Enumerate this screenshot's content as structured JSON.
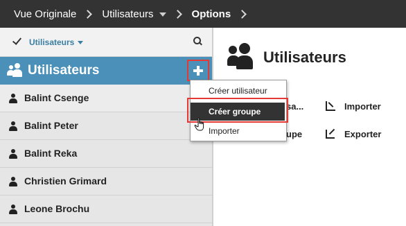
{
  "breadcrumb": {
    "items": [
      {
        "label": "Vue Originale"
      },
      {
        "label": "Utilisateurs"
      },
      {
        "label": "Options"
      }
    ]
  },
  "filter": {
    "label": "Utilisateurs"
  },
  "section": {
    "title": "Utilisateurs"
  },
  "users": [
    {
      "name": "Balint Csenge"
    },
    {
      "name": "Balint Peter"
    },
    {
      "name": "Balint Reka"
    },
    {
      "name": "Christien Grimard"
    },
    {
      "name": "Leone Brochu"
    }
  ],
  "main": {
    "title": "Utilisateurs",
    "actions": {
      "partial_left_1": "sa...",
      "partial_left_2": "upe",
      "import": "Importer",
      "export": "Exporter"
    }
  },
  "menu": {
    "items": [
      {
        "label": "Créer utilisateur"
      },
      {
        "label": "Créer groupe"
      },
      {
        "label": "Importer"
      }
    ]
  },
  "colors": {
    "topbar": "#333333",
    "accent": "#4a90b8",
    "highlight": "#e53935"
  }
}
